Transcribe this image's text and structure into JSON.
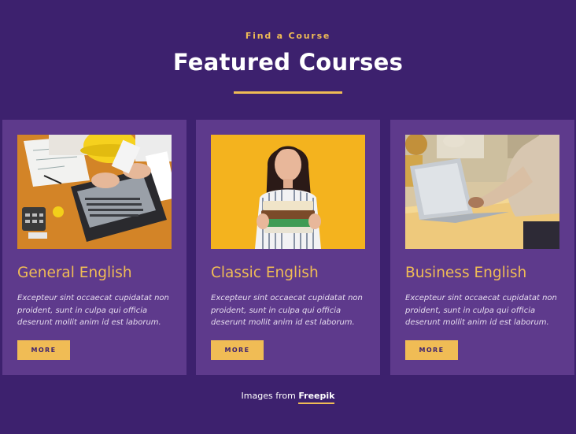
{
  "section": {
    "eyebrow": "Find a Course",
    "title": "Featured Courses"
  },
  "courses": [
    {
      "title": "General English",
      "description": "Excepteur sint occaecat cupidatat non proident, sunt in culpa qui officia deserunt mollit anim id est laborum.",
      "button_label": "MORE",
      "image": "person-using-laptop-on-desk-with-blueprints"
    },
    {
      "title": "Classic English",
      "description": "Excepteur sint occaecat cupidatat non proident, sunt in culpa qui officia deserunt mollit anim id est laborum.",
      "button_label": "MORE",
      "image": "woman-holding-stack-of-books"
    },
    {
      "title": "Business English",
      "description": "Excepteur sint occaecat cupidatat non proident, sunt in culpa qui officia deserunt mollit anim id est laborum.",
      "button_label": "MORE",
      "image": "person-typing-on-laptop-at-table"
    }
  ],
  "credit": {
    "prefix": "Images from",
    "link_label": "Freepik"
  },
  "colors": {
    "background": "#3d216e",
    "card": "#5e3a8c",
    "accent": "#f0bc55",
    "text": "#ffffff"
  }
}
